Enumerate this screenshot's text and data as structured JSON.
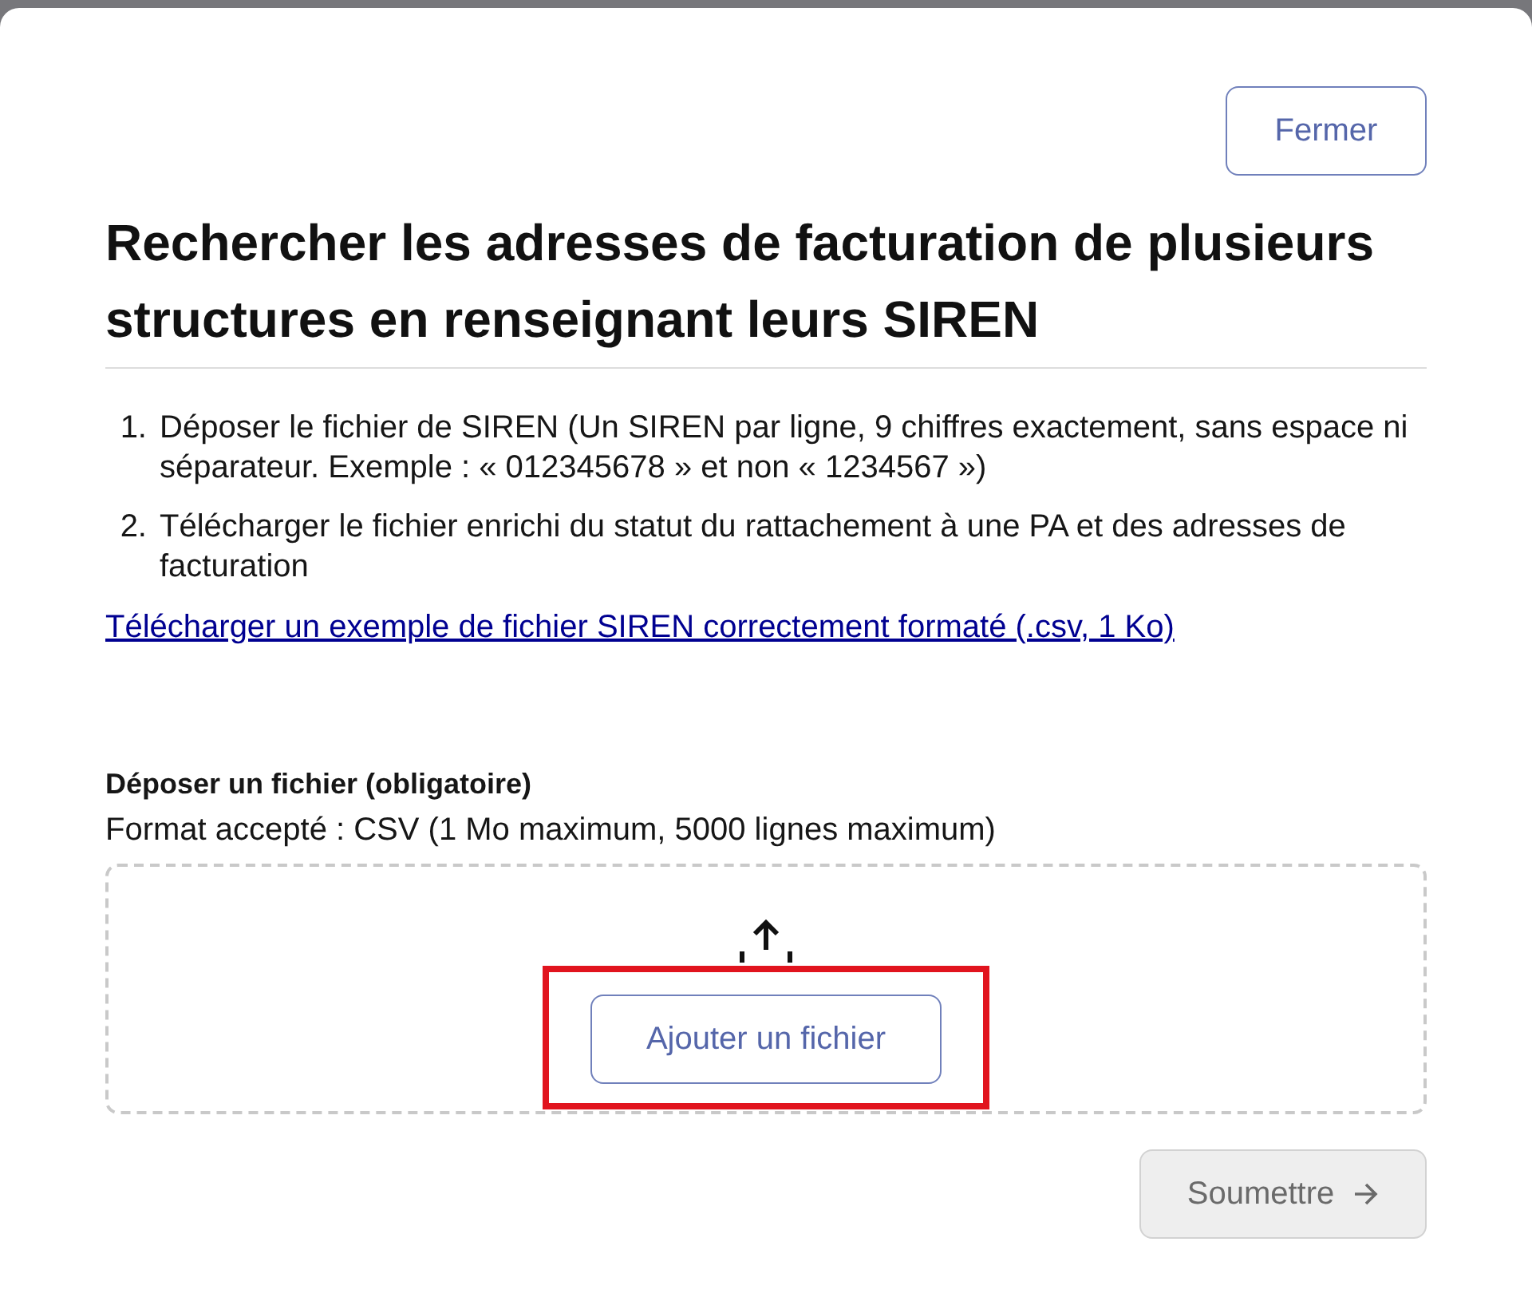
{
  "close_button": "Fermer",
  "title": "Rechercher les adresses de facturation de plusieurs structures en renseignant leurs SIREN",
  "steps": [
    {
      "number": "1.",
      "text": "Déposer le fichier de SIREN (Un SIREN par ligne, 9 chiffres exactement, sans espace ni séparateur. Exemple : « 012345678 » et non « 1234567 »)"
    },
    {
      "number": "2.",
      "text": "Télécharger le fichier enrichi du statut du rattachement à une PA et des adresses de facturation"
    }
  ],
  "example_link": "Télécharger un exemple de fichier SIREN correctement formaté (.csv, 1 Ko)",
  "upload": {
    "label": "Déposer un fichier (obligatoire)",
    "hint": "Format accepté : CSV (1 Mo maximum, 5000 lignes maximum)",
    "add_button": {
      "label": "Ajouter un fichier",
      "highlighted": true
    }
  },
  "submit_button": {
    "label": "Soumettre",
    "disabled": true
  }
}
